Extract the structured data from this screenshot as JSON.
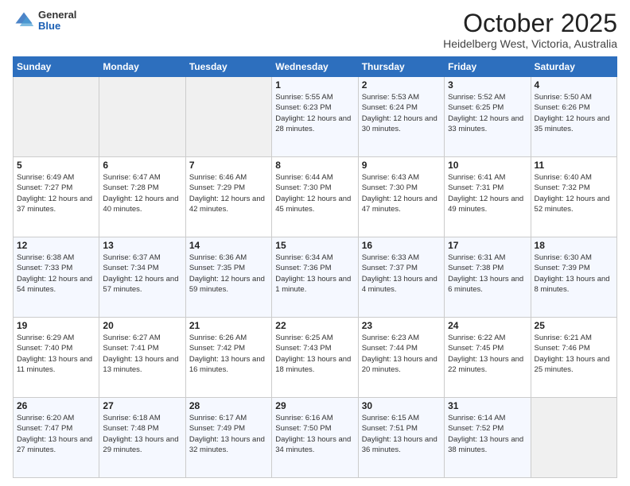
{
  "logo": {
    "general": "General",
    "blue": "Blue"
  },
  "header": {
    "month": "October 2025",
    "location": "Heidelberg West, Victoria, Australia"
  },
  "weekdays": [
    "Sunday",
    "Monday",
    "Tuesday",
    "Wednesday",
    "Thursday",
    "Friday",
    "Saturday"
  ],
  "weeks": [
    [
      {
        "day": "",
        "empty": true
      },
      {
        "day": "",
        "empty": true
      },
      {
        "day": "",
        "empty": true
      },
      {
        "day": "1",
        "sunrise": "5:55 AM",
        "sunset": "6:23 PM",
        "daylight": "12 hours and 28 minutes."
      },
      {
        "day": "2",
        "sunrise": "5:53 AM",
        "sunset": "6:24 PM",
        "daylight": "12 hours and 30 minutes."
      },
      {
        "day": "3",
        "sunrise": "5:52 AM",
        "sunset": "6:25 PM",
        "daylight": "12 hours and 33 minutes."
      },
      {
        "day": "4",
        "sunrise": "5:50 AM",
        "sunset": "6:26 PM",
        "daylight": "12 hours and 35 minutes."
      }
    ],
    [
      {
        "day": "5",
        "sunrise": "6:49 AM",
        "sunset": "7:27 PM",
        "daylight": "12 hours and 37 minutes."
      },
      {
        "day": "6",
        "sunrise": "6:47 AM",
        "sunset": "7:28 PM",
        "daylight": "12 hours and 40 minutes."
      },
      {
        "day": "7",
        "sunrise": "6:46 AM",
        "sunset": "7:29 PM",
        "daylight": "12 hours and 42 minutes."
      },
      {
        "day": "8",
        "sunrise": "6:44 AM",
        "sunset": "7:30 PM",
        "daylight": "12 hours and 45 minutes."
      },
      {
        "day": "9",
        "sunrise": "6:43 AM",
        "sunset": "7:30 PM",
        "daylight": "12 hours and 47 minutes."
      },
      {
        "day": "10",
        "sunrise": "6:41 AM",
        "sunset": "7:31 PM",
        "daylight": "12 hours and 49 minutes."
      },
      {
        "day": "11",
        "sunrise": "6:40 AM",
        "sunset": "7:32 PM",
        "daylight": "12 hours and 52 minutes."
      }
    ],
    [
      {
        "day": "12",
        "sunrise": "6:38 AM",
        "sunset": "7:33 PM",
        "daylight": "12 hours and 54 minutes."
      },
      {
        "day": "13",
        "sunrise": "6:37 AM",
        "sunset": "7:34 PM",
        "daylight": "12 hours and 57 minutes."
      },
      {
        "day": "14",
        "sunrise": "6:36 AM",
        "sunset": "7:35 PM",
        "daylight": "12 hours and 59 minutes."
      },
      {
        "day": "15",
        "sunrise": "6:34 AM",
        "sunset": "7:36 PM",
        "daylight": "13 hours and 1 minute."
      },
      {
        "day": "16",
        "sunrise": "6:33 AM",
        "sunset": "7:37 PM",
        "daylight": "13 hours and 4 minutes."
      },
      {
        "day": "17",
        "sunrise": "6:31 AM",
        "sunset": "7:38 PM",
        "daylight": "13 hours and 6 minutes."
      },
      {
        "day": "18",
        "sunrise": "6:30 AM",
        "sunset": "7:39 PM",
        "daylight": "13 hours and 8 minutes."
      }
    ],
    [
      {
        "day": "19",
        "sunrise": "6:29 AM",
        "sunset": "7:40 PM",
        "daylight": "13 hours and 11 minutes."
      },
      {
        "day": "20",
        "sunrise": "6:27 AM",
        "sunset": "7:41 PM",
        "daylight": "13 hours and 13 minutes."
      },
      {
        "day": "21",
        "sunrise": "6:26 AM",
        "sunset": "7:42 PM",
        "daylight": "13 hours and 16 minutes."
      },
      {
        "day": "22",
        "sunrise": "6:25 AM",
        "sunset": "7:43 PM",
        "daylight": "13 hours and 18 minutes."
      },
      {
        "day": "23",
        "sunrise": "6:23 AM",
        "sunset": "7:44 PM",
        "daylight": "13 hours and 20 minutes."
      },
      {
        "day": "24",
        "sunrise": "6:22 AM",
        "sunset": "7:45 PM",
        "daylight": "13 hours and 22 minutes."
      },
      {
        "day": "25",
        "sunrise": "6:21 AM",
        "sunset": "7:46 PM",
        "daylight": "13 hours and 25 minutes."
      }
    ],
    [
      {
        "day": "26",
        "sunrise": "6:20 AM",
        "sunset": "7:47 PM",
        "daylight": "13 hours and 27 minutes."
      },
      {
        "day": "27",
        "sunrise": "6:18 AM",
        "sunset": "7:48 PM",
        "daylight": "13 hours and 29 minutes."
      },
      {
        "day": "28",
        "sunrise": "6:17 AM",
        "sunset": "7:49 PM",
        "daylight": "13 hours and 32 minutes."
      },
      {
        "day": "29",
        "sunrise": "6:16 AM",
        "sunset": "7:50 PM",
        "daylight": "13 hours and 34 minutes."
      },
      {
        "day": "30",
        "sunrise": "6:15 AM",
        "sunset": "7:51 PM",
        "daylight": "13 hours and 36 minutes."
      },
      {
        "day": "31",
        "sunrise": "6:14 AM",
        "sunset": "7:52 PM",
        "daylight": "13 hours and 38 minutes."
      },
      {
        "day": "",
        "empty": true
      }
    ]
  ],
  "labels": {
    "sunrise": "Sunrise:",
    "sunset": "Sunset:",
    "daylight": "Daylight:"
  }
}
